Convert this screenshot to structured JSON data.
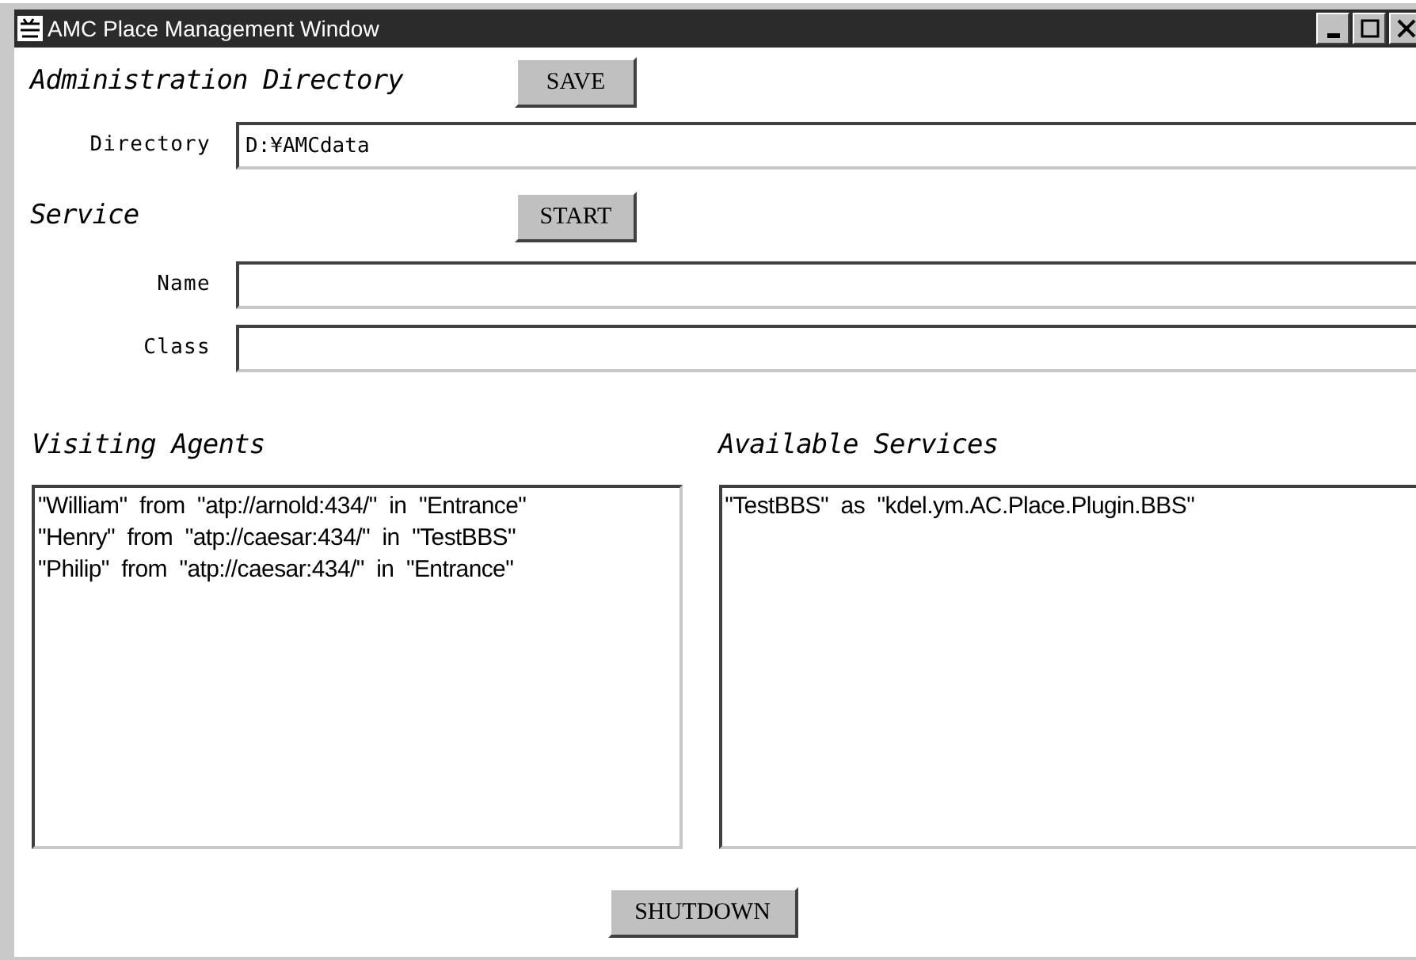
{
  "window": {
    "title": "AMC Place Management Window"
  },
  "admin": {
    "heading": "Administration Directory",
    "button": "SAVE",
    "fields": [
      {
        "label": "Directory",
        "value": "D:¥AMCdata"
      }
    ]
  },
  "service": {
    "heading": "Service",
    "button": "START",
    "fields": [
      {
        "label": "Name"
      },
      {
        "label": "Class"
      }
    ]
  },
  "visiting_agents": {
    "heading": "Visiting Agents",
    "items": [
      "\"William\"  from  \"atp://arnold:434/\"  in  \"Entrance\"",
      "\"Henry\"  from  \"atp://caesar:434/\"  in  \"TestBBS\"",
      "\"Philip\"  from  \"atp://caesar:434/\"  in  \"Entrance\""
    ]
  },
  "available_services": {
    "heading": "Available Services",
    "items": [
      "\"TestBBS\"  as  \"kdel.ym.AC.Place.Plugin.BBS\""
    ]
  },
  "shutdown_button": "SHUTDOWN"
}
